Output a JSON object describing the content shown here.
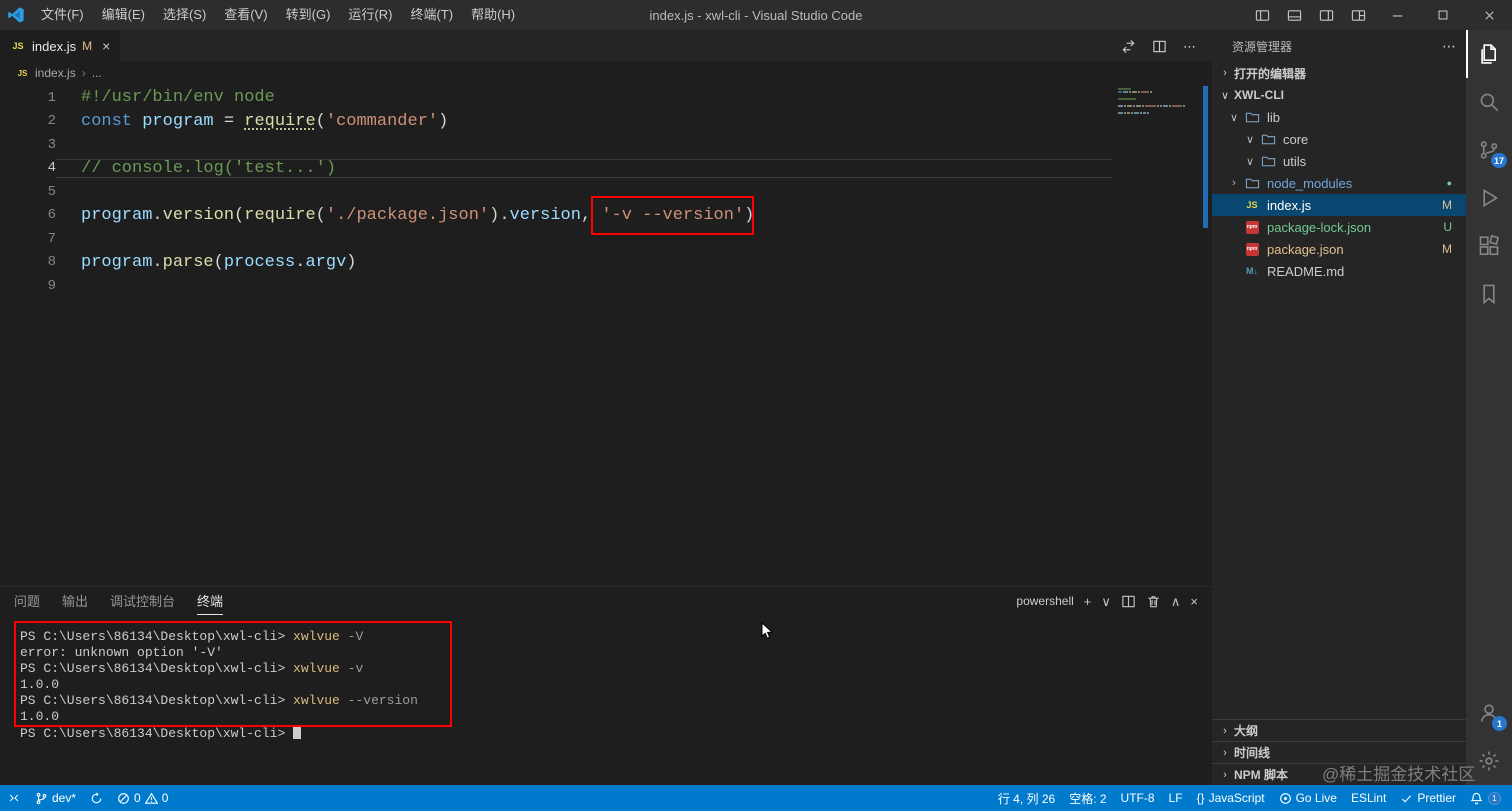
{
  "title_bar": {
    "menus": [
      "文件(F)",
      "编辑(E)",
      "选择(S)",
      "查看(V)",
      "转到(G)",
      "运行(R)",
      "终端(T)",
      "帮助(H)"
    ],
    "title": "index.js - xwl-cli - Visual Studio Code",
    "window_icons": [
      "layout-sidebar-left-icon",
      "layout-panel-icon",
      "layout-sidebar-right-icon",
      "layout-customize-icon",
      "minimize-icon",
      "maximize-icon",
      "close-window-icon"
    ]
  },
  "editor_tabs": {
    "active_tab": {
      "label": "index.js",
      "git_badge": "M"
    },
    "actions": [
      "open-changes-icon",
      "split-editor-icon",
      "more-actions-icon"
    ]
  },
  "breadcrumb": {
    "file": "index.js",
    "separator": "›",
    "more": "..."
  },
  "editor": {
    "cursor_line": 4,
    "lines": [
      {
        "num": 1,
        "tokens": [
          {
            "t": "#!/usr/bin/env node",
            "c": "cm"
          }
        ]
      },
      {
        "num": 2,
        "tokens": [
          {
            "t": "const ",
            "c": "kw"
          },
          {
            "t": "program",
            "c": "var"
          },
          {
            "t": " = ",
            "c": "pl"
          },
          {
            "t": "require",
            "c": "fn",
            "u": true
          },
          {
            "t": "(",
            "c": "pl"
          },
          {
            "t": "'commander'",
            "c": "str"
          },
          {
            "t": ")",
            "c": "pl"
          }
        ]
      },
      {
        "num": 3,
        "tokens": []
      },
      {
        "num": 4,
        "tokens": [
          {
            "t": "// console.log('test...')",
            "c": "cm"
          }
        ]
      },
      {
        "num": 5,
        "tokens": []
      },
      {
        "num": 6,
        "tokens": [
          {
            "t": "program",
            "c": "var"
          },
          {
            "t": ".",
            "c": "pl"
          },
          {
            "t": "version",
            "c": "fn"
          },
          {
            "t": "(",
            "c": "pl"
          },
          {
            "t": "require",
            "c": "fn"
          },
          {
            "t": "(",
            "c": "pl"
          },
          {
            "t": "'./package.json'",
            "c": "str"
          },
          {
            "t": ")",
            "c": "pl"
          },
          {
            "t": ".",
            "c": "pl"
          },
          {
            "t": "version",
            "c": "var"
          },
          {
            "t": ", ",
            "c": "pl"
          },
          {
            "t": "'-v --version'",
            "c": "str",
            "box": true
          },
          {
            "t": ")",
            "c": "pl"
          }
        ]
      },
      {
        "num": 7,
        "tokens": []
      },
      {
        "num": 8,
        "tokens": [
          {
            "t": "program",
            "c": "var"
          },
          {
            "t": ".",
            "c": "pl"
          },
          {
            "t": "parse",
            "c": "fn"
          },
          {
            "t": "(",
            "c": "pl"
          },
          {
            "t": "process",
            "c": "var"
          },
          {
            "t": ".",
            "c": "pl"
          },
          {
            "t": "argv",
            "c": "var"
          },
          {
            "t": ")",
            "c": "pl"
          }
        ]
      },
      {
        "num": 9,
        "tokens": []
      }
    ]
  },
  "panel": {
    "tabs": [
      {
        "label": "问题",
        "active": false
      },
      {
        "label": "输出",
        "active": false
      },
      {
        "label": "调试控制台",
        "active": false
      },
      {
        "label": "终端",
        "active": true
      }
    ],
    "shell": "powershell",
    "actions": [
      "plus-icon",
      "chevron-down-icon",
      "split-icon",
      "trash-icon",
      "chevron-up-icon",
      "close-icon"
    ],
    "terminal_lines": [
      {
        "prompt": "PS C:\\Users\\86134\\Desktop\\xwl-cli> ",
        "cmd": "xwlvue",
        "args": " -V"
      },
      {
        "out": "error: unknown option '-V'"
      },
      {
        "prompt": "PS C:\\Users\\86134\\Desktop\\xwl-cli> ",
        "cmd": "xwlvue",
        "args": " -v"
      },
      {
        "out": "1.0.0"
      },
      {
        "prompt": "PS C:\\Users\\86134\\Desktop\\xwl-cli> ",
        "cmd": "xwlvue",
        "args": " --version"
      },
      {
        "out": "1.0.0"
      },
      {
        "prompt": "PS C:\\Users\\86134\\Desktop\\xwl-cli> ",
        "cursor": true
      }
    ]
  },
  "sidebar": {
    "title": "资源管理器",
    "open_editors_label": "打开的编辑器",
    "project": "XWL-CLI",
    "tree": [
      {
        "label": "lib",
        "type": "folder",
        "chevron": "expanded",
        "level": 1
      },
      {
        "label": "core",
        "type": "folder",
        "chevron": "expanded",
        "level": 2
      },
      {
        "label": "utils",
        "type": "folder",
        "chevron": "expanded",
        "level": 2
      },
      {
        "label": "node_modules",
        "type": "folder",
        "chevron": "collapsed",
        "level": 1,
        "dot": true,
        "name_color": "#6FA8DC"
      },
      {
        "label": "index.js",
        "type": "js",
        "level": 1,
        "badge": "M",
        "badge_color": "#E2C08D",
        "selected": true
      },
      {
        "label": "package-lock.json",
        "type": "npm",
        "level": 1,
        "badge": "U",
        "badge_color": "#73C991",
        "name_color": "#73C991"
      },
      {
        "label": "package.json",
        "type": "npm",
        "level": 1,
        "badge": "M",
        "badge_color": "#E2C08D",
        "name_color": "#E2C08D"
      },
      {
        "label": "README.md",
        "type": "md",
        "level": 1
      }
    ],
    "bottom_sections": [
      "大纲",
      "时间线",
      "NPM 脚本"
    ]
  },
  "activity_bar": {
    "items": [
      {
        "name": "explorer",
        "icon": "files-icon",
        "active": true
      },
      {
        "name": "search",
        "icon": "search-icon"
      },
      {
        "name": "source-control",
        "icon": "source-control-icon",
        "badge": "17"
      },
      {
        "name": "run-debug",
        "icon": "run-debug-icon"
      },
      {
        "name": "extensions",
        "icon": "extensions-icon"
      },
      {
        "name": "bookmarks",
        "icon": "bookmark-icon"
      }
    ],
    "bottom_items": [
      {
        "name": "accounts",
        "icon": "account-icon",
        "badge": "1"
      },
      {
        "name": "settings",
        "icon": "settings-gear-icon"
      }
    ]
  },
  "status_bar": {
    "left": [
      {
        "name": "remote",
        "icon": "remote-icon",
        "text": ""
      },
      {
        "name": "git-branch",
        "icon": "branch-icon",
        "text": "dev*"
      },
      {
        "name": "sync",
        "icon": "sync-icon",
        "text": ""
      },
      {
        "name": "problems",
        "icon": "error-icon",
        "text": "0",
        "icon2": "warning-icon",
        "text2": "0"
      }
    ],
    "right": [
      {
        "name": "cursor-position",
        "text": "行 4, 列 26"
      },
      {
        "name": "indentation",
        "text": "空格: 2"
      },
      {
        "name": "encoding",
        "text": "UTF-8"
      },
      {
        "name": "eol",
        "text": "LF"
      },
      {
        "name": "language",
        "icon": "braces-icon",
        "text": "JavaScript"
      },
      {
        "name": "go-live",
        "icon": "broadcast-icon",
        "text": "Go Live"
      },
      {
        "name": "eslint",
        "text": "ESLint"
      },
      {
        "name": "prettier",
        "icon": "check-icon",
        "text": "Prettier"
      },
      {
        "name": "notifications",
        "icon": "bell-icon",
        "text": "",
        "badge": "1"
      }
    ]
  },
  "watermark": "@稀土掘金技术社区",
  "colors": {
    "status_bar": "#007ACC",
    "highlight_red": "#FF0000",
    "modified": "#E2C08D",
    "untracked": "#73C991",
    "selection": "#094771"
  }
}
